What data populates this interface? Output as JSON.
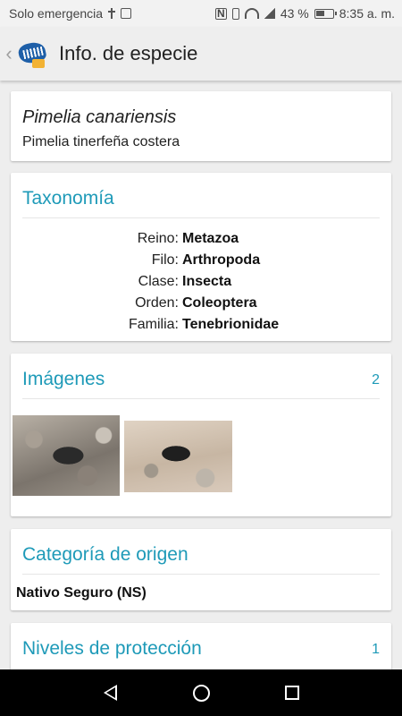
{
  "status_bar": {
    "carrier": "Solo emergencia",
    "battery": "43 %",
    "time": "8:35 a. m."
  },
  "app_bar": {
    "title": "Info. de especie"
  },
  "species": {
    "scientific_name": "Pimelia canariensis",
    "common_name": "Pimelia tinerfeña costera"
  },
  "taxonomy": {
    "title": "Taxonomía",
    "rows": [
      {
        "key": "Reino:",
        "value": "Metazoa"
      },
      {
        "key": "Filo:",
        "value": "Arthropoda"
      },
      {
        "key": "Clase:",
        "value": "Insecta"
      },
      {
        "key": "Orden:",
        "value": "Coleoptera"
      },
      {
        "key": "Familia:",
        "value": "Tenebrionidae"
      }
    ]
  },
  "images": {
    "title": "Imágenes",
    "count": "2"
  },
  "origin": {
    "title": "Categoría de origen",
    "value": "Nativo Seguro (NS)"
  },
  "protection": {
    "title": "Niveles de protección",
    "count": "1"
  },
  "colors": {
    "accent": "#1e9ab8",
    "app_bar": "#eeeeee",
    "background": "#eeeeee",
    "nav_bar": "#000000"
  },
  "icons": {
    "back": "chevron-left-icon",
    "logo": "app-logo-icon",
    "nav_back": "triangle-back-icon",
    "nav_home": "circle-home-icon",
    "nav_recent": "square-recent-icon"
  }
}
